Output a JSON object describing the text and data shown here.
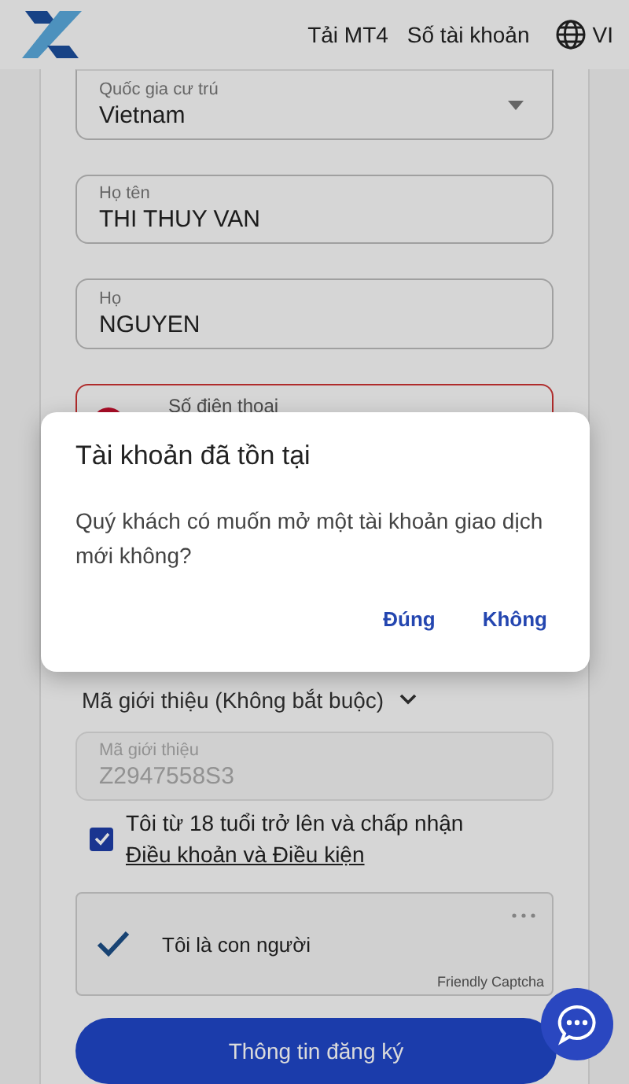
{
  "header": {
    "nav": [
      "Tải MT4",
      "Số tài khoản"
    ],
    "language": "VI"
  },
  "fields": [
    {
      "kind": "select",
      "label": "Quốc gia cư trú",
      "value": "Vietnam"
    },
    {
      "kind": "text",
      "label": "Họ tên",
      "value": "THI THUY VAN"
    },
    {
      "kind": "text",
      "label": "Họ",
      "value": "NGUYEN"
    },
    {
      "kind": "phone",
      "label": "Số điện thoại",
      "error": true
    }
  ],
  "referral": {
    "toggle": "Mã giới thiệu (Không bắt buộc)",
    "expanded": true,
    "label": "Mã giới thiệu",
    "value": "Z2947558S3",
    "disabled": true
  },
  "terms": {
    "checked": true,
    "text": "Tôi từ 18 tuổi trở lên và chấp nhận",
    "link": "Điều khoản và Điều kiện"
  },
  "captcha": {
    "checked": true,
    "label": "Tôi là con người",
    "brand": "Friendly Captcha"
  },
  "submit": "Thông tin đăng ký",
  "dialog": {
    "title": "Tài khoản đã tồn tại",
    "message": "Quý khách có muốn mở một tài khoản giao dịch mới không?",
    "buttons": [
      "Đúng",
      "Không"
    ]
  }
}
